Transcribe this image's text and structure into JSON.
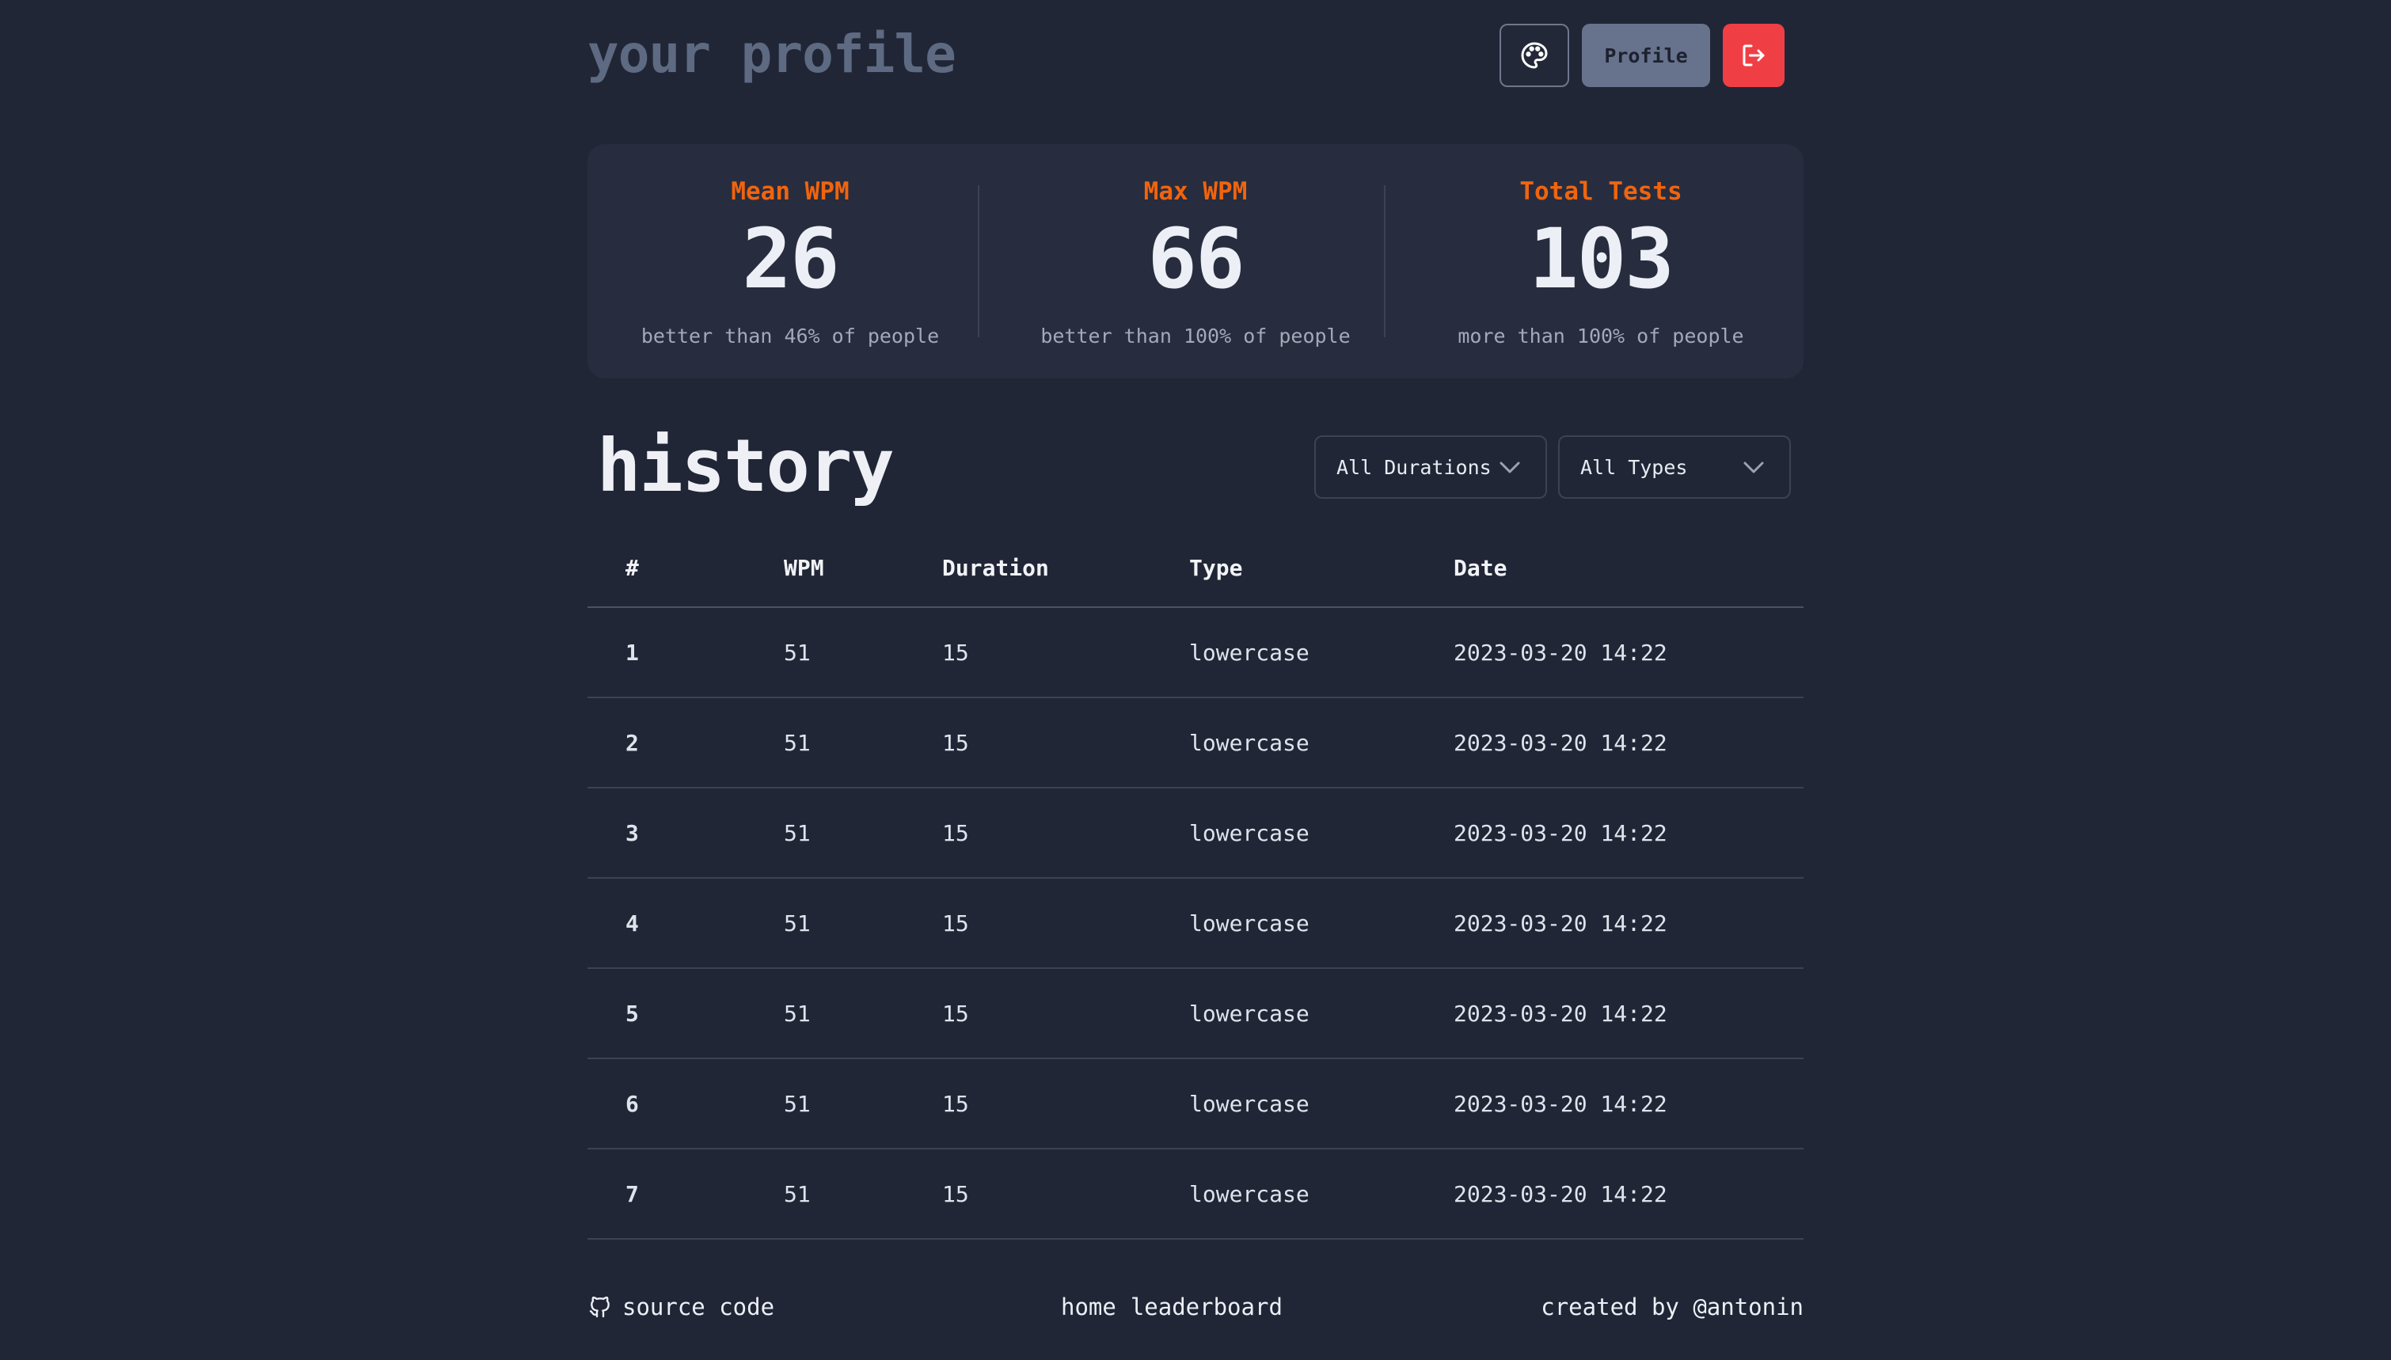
{
  "header": {
    "brand": "your profile",
    "theme_icon": "palette-icon",
    "profile_label": "Profile",
    "logout_icon": "logout-icon"
  },
  "stats": [
    {
      "label": "Mean WPM",
      "value": "26",
      "sub": "better than 46% of people"
    },
    {
      "label": "Max WPM",
      "value": "66",
      "sub": "better than 100% of people"
    },
    {
      "label": "Total Tests",
      "value": "103",
      "sub": "more than 100% of people"
    }
  ],
  "history": {
    "title": "history",
    "duration_filter": "All Durations",
    "type_filter": "All Types",
    "columns": {
      "num": "#",
      "wpm": "WPM",
      "duration": "Duration",
      "type": "Type",
      "date": "Date"
    },
    "rows": [
      {
        "num": "1",
        "wpm": "51",
        "duration": "15",
        "type": "lowercase",
        "date": "2023-03-20 14:22"
      },
      {
        "num": "2",
        "wpm": "51",
        "duration": "15",
        "type": "lowercase",
        "date": "2023-03-20 14:22"
      },
      {
        "num": "3",
        "wpm": "51",
        "duration": "15",
        "type": "lowercase",
        "date": "2023-03-20 14:22"
      },
      {
        "num": "4",
        "wpm": "51",
        "duration": "15",
        "type": "lowercase",
        "date": "2023-03-20 14:22"
      },
      {
        "num": "5",
        "wpm": "51",
        "duration": "15",
        "type": "lowercase",
        "date": "2023-03-20 14:22"
      },
      {
        "num": "6",
        "wpm": "51",
        "duration": "15",
        "type": "lowercase",
        "date": "2023-03-20 14:22"
      },
      {
        "num": "7",
        "wpm": "51",
        "duration": "15",
        "type": "lowercase",
        "date": "2023-03-20 14:22"
      }
    ]
  },
  "footer": {
    "source_icon": "github-icon",
    "source_label": "source code",
    "nav_home": "home",
    "nav_leaderboard": "leaderboard",
    "credit": "created by @antonin"
  },
  "colors": {
    "background": "#212636",
    "accent": "#f0640e",
    "logout": "#ef3f45",
    "profile_button": "#67728c"
  }
}
